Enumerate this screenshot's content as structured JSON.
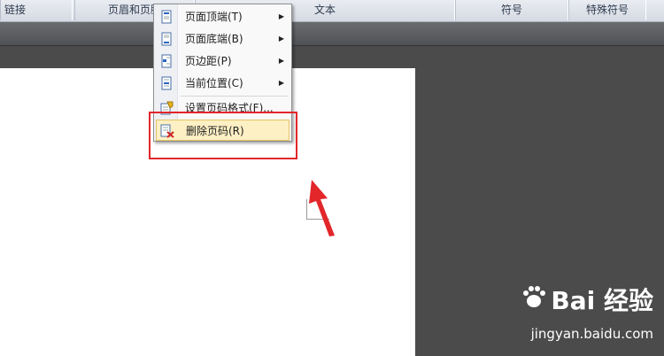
{
  "ribbon": {
    "groups": [
      "链接",
      "页眉和页脚",
      "文本",
      "符号",
      "特殊符号"
    ]
  },
  "menu": {
    "items": [
      {
        "label": "页面顶端(T)",
        "submenu": true,
        "icon": "page-top-icon"
      },
      {
        "label": "页面底端(B)",
        "submenu": true,
        "icon": "page-bottom-icon"
      },
      {
        "label": "页边距(P)",
        "submenu": true,
        "icon": "page-margin-icon"
      },
      {
        "label": "当前位置(C)",
        "submenu": true,
        "icon": "current-position-icon"
      },
      {
        "label": "设置页码格式(F)...",
        "submenu": false,
        "icon": "format-page-number-icon"
      },
      {
        "label": "删除页码(R)",
        "submenu": false,
        "icon": "remove-page-number-icon"
      }
    ]
  },
  "watermark": {
    "brand": "Bai 经验",
    "url": "jingyan.baidu.com"
  },
  "colors": {
    "callout": "#e2262a",
    "arrow": "#e2262a",
    "highlight": "#fdf0c4"
  }
}
